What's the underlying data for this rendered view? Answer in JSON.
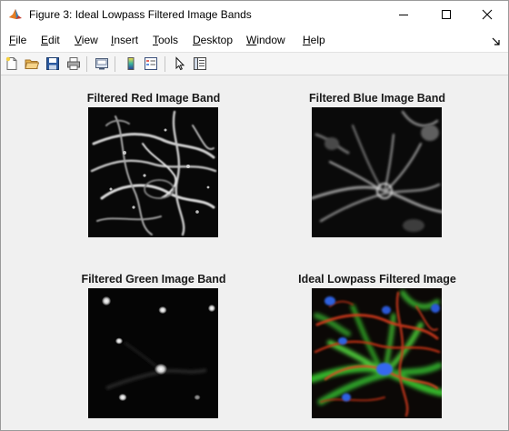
{
  "window": {
    "title": "Figure 3: Ideal Lowpass Filtered Image Bands",
    "icon": "matlab-logo-icon",
    "controls": {
      "minimize": "—",
      "maximize": "☐",
      "close": "✕"
    }
  },
  "menubar": {
    "items": [
      {
        "label": "File",
        "accel": "F",
        "rest": "ile"
      },
      {
        "label": "Edit",
        "accel": "E",
        "rest": "dit"
      },
      {
        "label": "View",
        "accel": "V",
        "rest": "iew"
      },
      {
        "label": "Insert",
        "accel": "I",
        "rest": "nsert"
      },
      {
        "label": "Tools",
        "accel": "T",
        "rest": "ools"
      },
      {
        "label": "Desktop",
        "accel": "D",
        "rest": "esktop"
      },
      {
        "label": "Window",
        "accel": "W",
        "rest": "indow"
      },
      {
        "label": "Help",
        "accel": "H",
        "rest": "elp"
      }
    ]
  },
  "toolbar": {
    "buttons": [
      {
        "name": "new-figure-button",
        "icon": "new-document-icon"
      },
      {
        "name": "open-file-button",
        "icon": "folder-open-icon"
      },
      {
        "name": "save-figure-button",
        "icon": "floppy-disk-icon"
      },
      {
        "name": "print-figure-button",
        "icon": "printer-icon"
      },
      {
        "name": "link-plot-button",
        "icon": "link-plot-icon"
      },
      {
        "name": "insert-colorbar-button",
        "icon": "colorbar-icon"
      },
      {
        "name": "insert-legend-button",
        "icon": "legend-icon"
      },
      {
        "name": "edit-plot-button",
        "icon": "pointer-arrow-icon"
      },
      {
        "name": "property-inspector-button",
        "icon": "property-inspector-icon"
      }
    ]
  },
  "figure": {
    "panels": [
      {
        "title": "Filtered Red Image Band",
        "image": "grayscale-red-band-image"
      },
      {
        "title": "Filtered Blue Image Band",
        "image": "grayscale-blue-band-image"
      },
      {
        "title": "Filtered Green Image Band",
        "image": "grayscale-green-band-image"
      },
      {
        "title": "Ideal Lowpass Filtered Image",
        "image": "color-composite-image"
      }
    ]
  },
  "colors": {
    "titlebar_bg": "#ffffff",
    "figure_bg": "#f0f0f0",
    "image_bg": "#050505"
  }
}
